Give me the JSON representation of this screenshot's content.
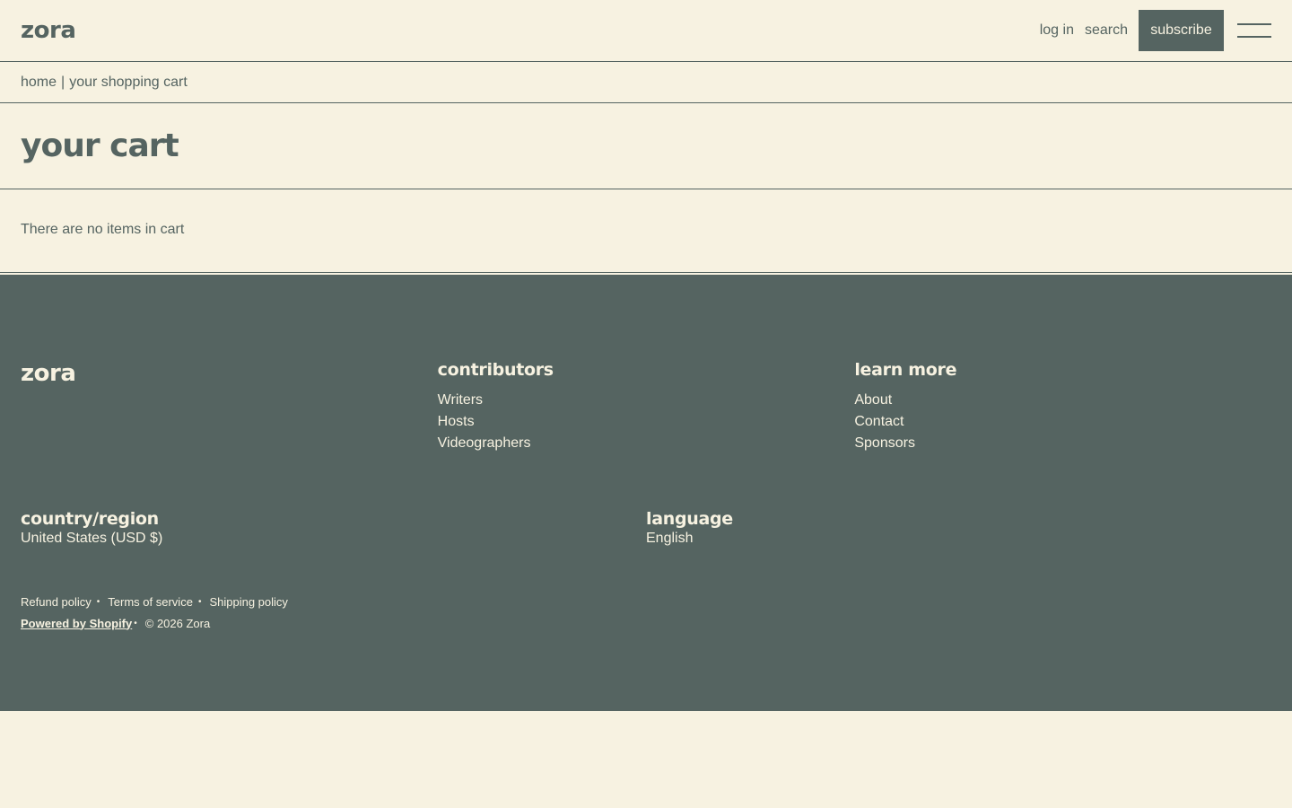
{
  "header": {
    "logo": "zora",
    "login_label": "log in",
    "search_label": "search",
    "subscribe_label": "subscribe"
  },
  "breadcrumb": {
    "home": "home",
    "separator": "|",
    "current": "your shopping cart"
  },
  "page": {
    "title": "your cart",
    "empty_message": "There are no items in cart"
  },
  "footer": {
    "logo": "zora",
    "contributors": {
      "heading": "contributors",
      "links": [
        "Writers",
        "Hosts",
        "Videographers"
      ]
    },
    "learn_more": {
      "heading": "learn more",
      "links": [
        "About",
        "Contact",
        "Sponsors"
      ]
    },
    "country": {
      "heading": "country/region",
      "value": "United States (USD $)"
    },
    "language": {
      "heading": "language",
      "value": "English"
    },
    "policies": [
      "Refund policy",
      "Terms of service",
      "Shipping policy"
    ],
    "powered_by": "Powered by Shopify",
    "copyright": "© 2026 Zora"
  },
  "colors": {
    "background": "#f7f2e1",
    "accent": "#556461"
  },
  "icons": {
    "menu": "hamburger-menu-icon"
  }
}
